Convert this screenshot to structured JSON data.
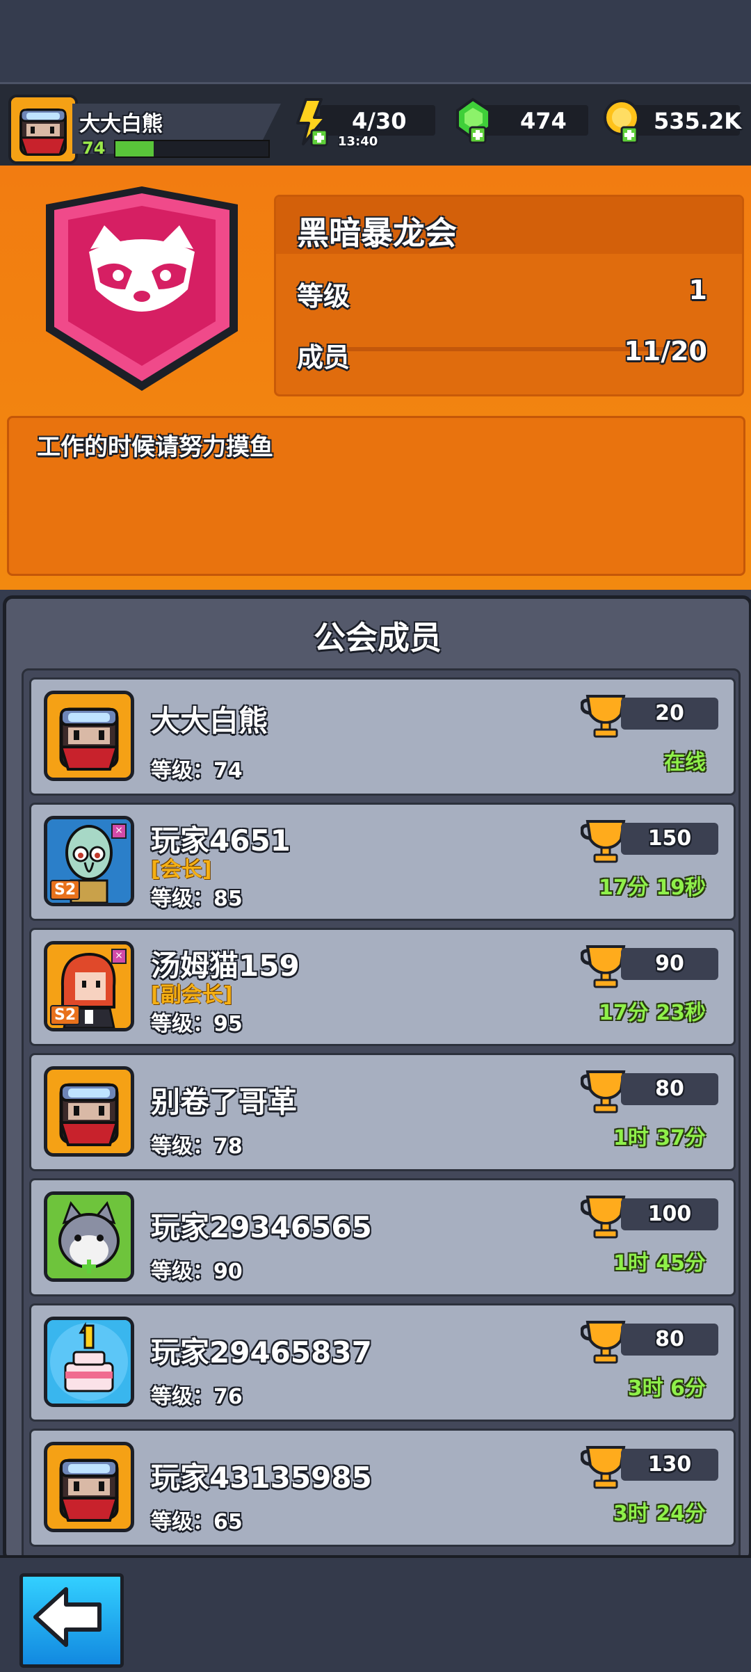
{
  "player": {
    "name": "大大白熊",
    "level": "74",
    "xp_progress": 0.25
  },
  "resources": {
    "energy": "4/30",
    "energy_timer": "13:40",
    "gems": "474",
    "coins": "535.2K"
  },
  "guild": {
    "name": "黑暗暴龙会",
    "level_label": "等级",
    "level_value": "1",
    "members_label": "成员",
    "members_value": "11/20",
    "motto": "工作的时候请努力摸鱼"
  },
  "members_panel": {
    "title": "公会成员",
    "members": [
      {
        "name": "大大白熊",
        "role": "",
        "level": "等级：74",
        "trophies": "20",
        "status": "在线",
        "season": ""
      },
      {
        "name": "玩家4651",
        "role": "[会长]",
        "level": "等级：85",
        "trophies": "150",
        "status": "17分 19秒",
        "season": "S2"
      },
      {
        "name": "汤姆猫159",
        "role": "[副会长]",
        "level": "等级：95",
        "trophies": "90",
        "status": "17分 23秒",
        "season": "S2"
      },
      {
        "name": "别卷了哥革",
        "role": "",
        "level": "等级：78",
        "trophies": "80",
        "status": "1时 37分",
        "season": ""
      },
      {
        "name": "玩家29346565",
        "role": "",
        "level": "等级：90",
        "trophies": "100",
        "status": "1时 45分",
        "season": ""
      },
      {
        "name": "玩家29465837",
        "role": "",
        "level": "等级：76",
        "trophies": "80",
        "status": "3时 6分",
        "season": ""
      },
      {
        "name": "玩家43135985",
        "role": "",
        "level": "等级：65",
        "trophies": "130",
        "status": "3时 24分",
        "season": ""
      }
    ]
  },
  "icons": {
    "energy": "lightning-plus-icon",
    "gems": "green-gem-plus-icon",
    "coins": "gold-coin-plus-icon",
    "trophy": "trophy-icon",
    "back": "back-arrow-icon",
    "guild_emblem": "raccoon-shield-icon"
  },
  "colors": {
    "accent_orange": "#f27c11",
    "online_green": "#8ff04a",
    "role_gold": "#f5b014"
  }
}
